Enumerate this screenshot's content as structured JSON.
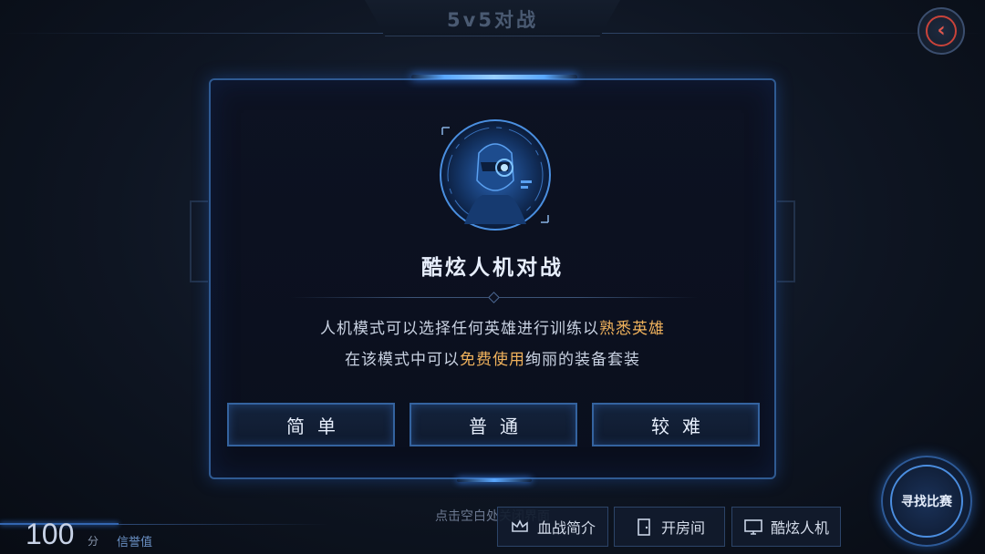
{
  "header": {
    "title": "5v5对战"
  },
  "dialog": {
    "mode_title": "酷炫人机对战",
    "desc_line1_a": "人机模式可以选择任何英雄进行训练以",
    "desc_line1_hl": "熟悉英雄",
    "desc_line2_a": "在该模式中可以",
    "desc_line2_hl": "免费使用",
    "desc_line2_b": "绚丽的装备套装",
    "difficulty": [
      "简单",
      "普通",
      "较难"
    ],
    "close_hint": "点击空白处关闭界面",
    "highlight_color": "#f0b25c"
  },
  "footer": {
    "score": "100",
    "score_unit": "分",
    "score_label": "信誉值",
    "tabs": [
      {
        "label": "血战简介",
        "icon": "crown-icon"
      },
      {
        "label": "开房间",
        "icon": "door-icon"
      },
      {
        "label": "酷炫人机",
        "icon": "monitor-icon"
      }
    ],
    "match_button": "寻找比赛"
  },
  "icons": {
    "back": "back-arrow-icon",
    "avatar": "robot-avatar-icon"
  },
  "colors": {
    "accent": "#3e8cff",
    "back_red": "#e0584e"
  }
}
